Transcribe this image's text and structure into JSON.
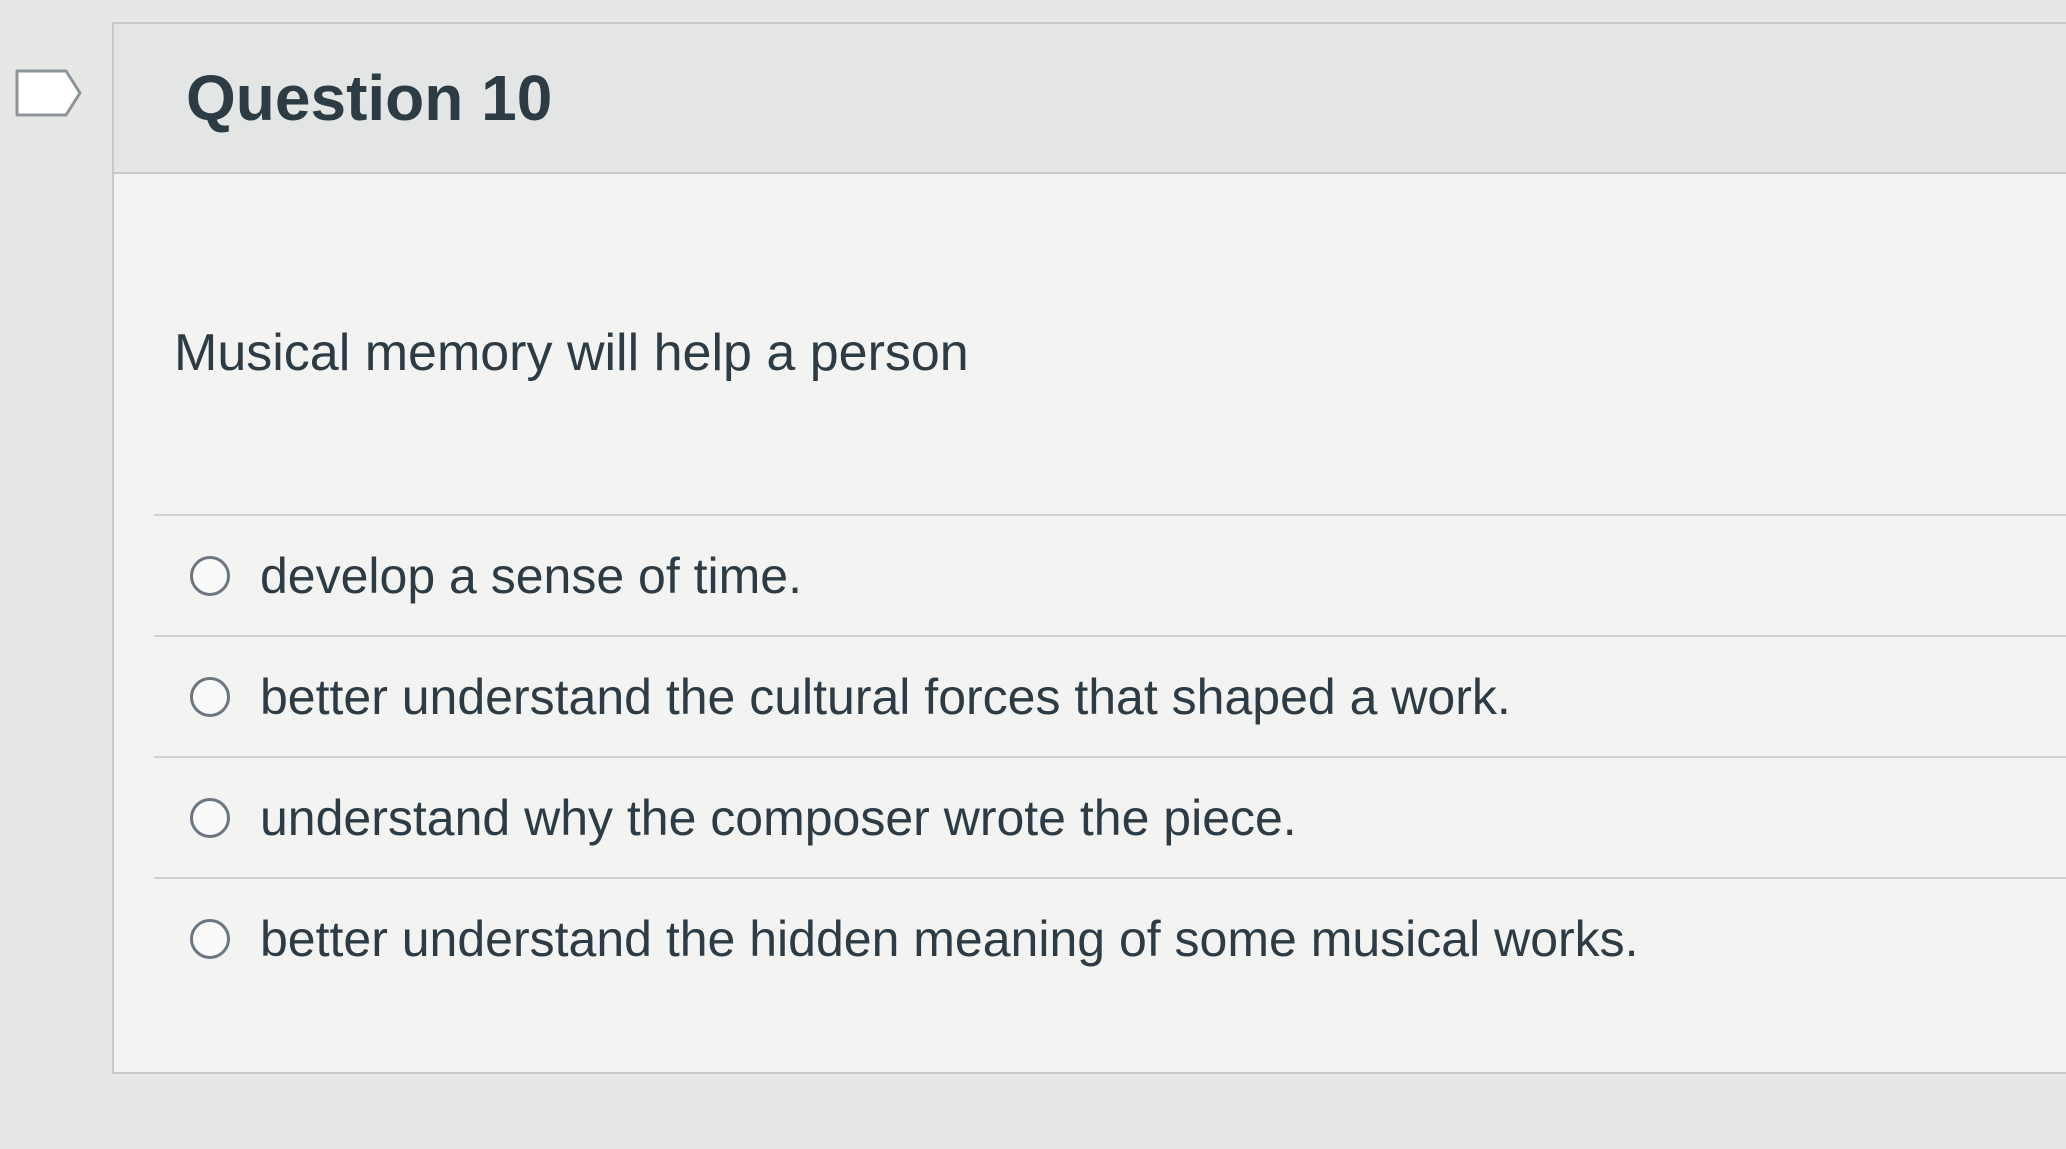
{
  "question": {
    "title": "Question 10",
    "prompt": "Musical memory will help a person",
    "answers": [
      {
        "label": "develop a sense of time.",
        "selected": false
      },
      {
        "label": "better understand the cultural forces that shaped a work.",
        "selected": false
      },
      {
        "label": "understand why the composer wrote the piece.",
        "selected": false
      },
      {
        "label": "better understand the hidden meaning of some musical works.",
        "selected": false
      }
    ]
  },
  "icons": {
    "flag": "flag-question-icon"
  },
  "colors": {
    "text": "#2d3b45",
    "header_bg": "#e4e5e5",
    "card_bg": "#f3f3f1",
    "border": "#c6c7c8"
  }
}
